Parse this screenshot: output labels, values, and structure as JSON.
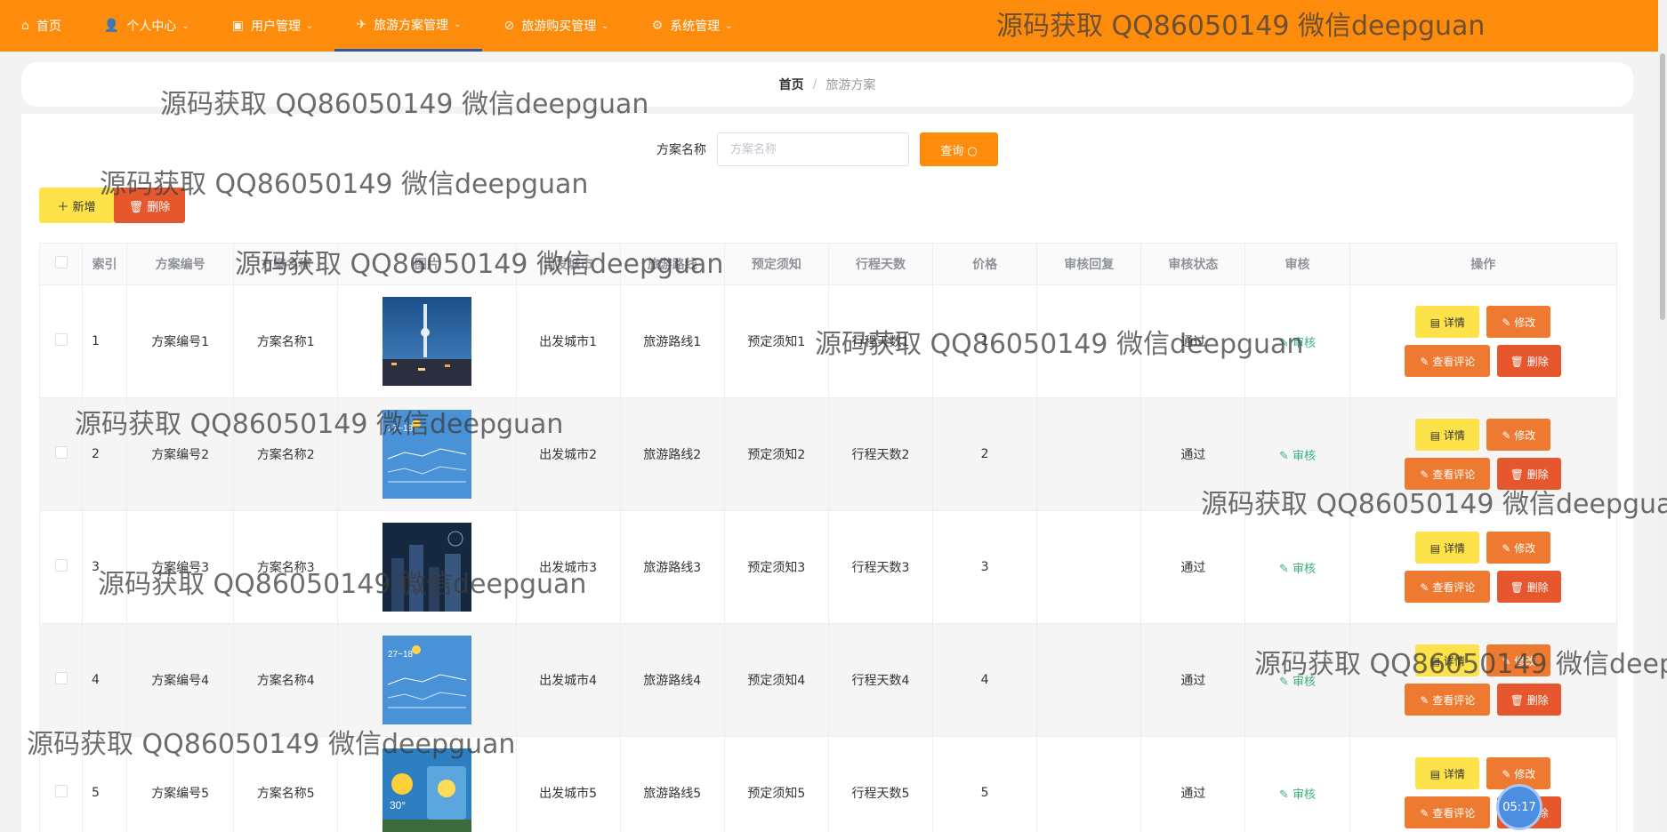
{
  "nav": {
    "items": [
      {
        "label": "首页",
        "icon": "home-icon",
        "caret": false,
        "active": false
      },
      {
        "label": "个人中心",
        "icon": "user-icon",
        "caret": true,
        "active": false
      },
      {
        "label": "用户管理",
        "icon": "briefcase-icon",
        "caret": true,
        "active": false
      },
      {
        "label": "旅游方案管理",
        "icon": "plane-icon",
        "caret": true,
        "active": true
      },
      {
        "label": "旅游购买管理",
        "icon": "cart-icon",
        "caret": true,
        "active": false
      },
      {
        "label": "系统管理",
        "icon": "gear-icon",
        "caret": true,
        "active": false
      }
    ]
  },
  "breadcrumb": {
    "home": "首页",
    "separator": "/",
    "current": "旅游方案"
  },
  "search": {
    "label": "方案名称",
    "placeholder": "方案名称",
    "query_label": "查询 ○"
  },
  "actions": {
    "add_label": "＋ 新增",
    "delete_label": "🗑 删除"
  },
  "table": {
    "headers": [
      "",
      "索引",
      "方案编号",
      "方案名称",
      "图片",
      "出发城市",
      "旅游路线",
      "预定须知",
      "行程天数",
      "价格",
      "审核回复",
      "审核状态",
      "审核",
      "操作"
    ],
    "audit_label": "✎ 审核",
    "ops": {
      "detail": "▤ 详情",
      "edit": "✎ 修改",
      "comment": "✎ 查看评论",
      "delete": "🗑 删除"
    },
    "rows": [
      {
        "index": "1",
        "code": "方案编号1",
        "name": "方案名称1",
        "image": "city-tower-night",
        "city": "出发城市1",
        "route": "旅游路线1",
        "notice": "预定须知1",
        "days": "行程天数1",
        "price": "1",
        "reply": "",
        "status": "通过"
      },
      {
        "index": "2",
        "code": "方案编号2",
        "name": "方案名称2",
        "image": "weather-chart-blue",
        "city": "出发城市2",
        "route": "旅游路线2",
        "notice": "预定须知2",
        "days": "行程天数2",
        "price": "2",
        "reply": "",
        "status": "通过"
      },
      {
        "index": "3",
        "code": "方案编号3",
        "name": "方案名称3",
        "image": "city-skyline-dark",
        "city": "出发城市3",
        "route": "旅游路线3",
        "notice": "预定须知3",
        "days": "行程天数3",
        "price": "3",
        "reply": "",
        "status": "通过"
      },
      {
        "index": "4",
        "code": "方案编号4",
        "name": "方案名称4",
        "image": "weather-chart-blue",
        "city": "出发城市4",
        "route": "旅游路线4",
        "notice": "预定须知4",
        "days": "行程天数4",
        "price": "4",
        "reply": "",
        "status": "通过"
      },
      {
        "index": "5",
        "code": "方案编号5",
        "name": "方案名称5",
        "image": "weather-app-sun",
        "city": "出发城市5",
        "route": "旅游路线5",
        "notice": "预定须知5",
        "days": "行程天数5",
        "price": "5",
        "reply": "",
        "status": "通过"
      }
    ]
  },
  "timer": "05:17",
  "watermark": "源码获取 QQ86050149 微信deepguan",
  "colors": {
    "nav": "#fd8c0d",
    "add": "#fde249",
    "delete": "#e6572e",
    "edit": "#ed7a30",
    "audit": "#3ab07a"
  }
}
